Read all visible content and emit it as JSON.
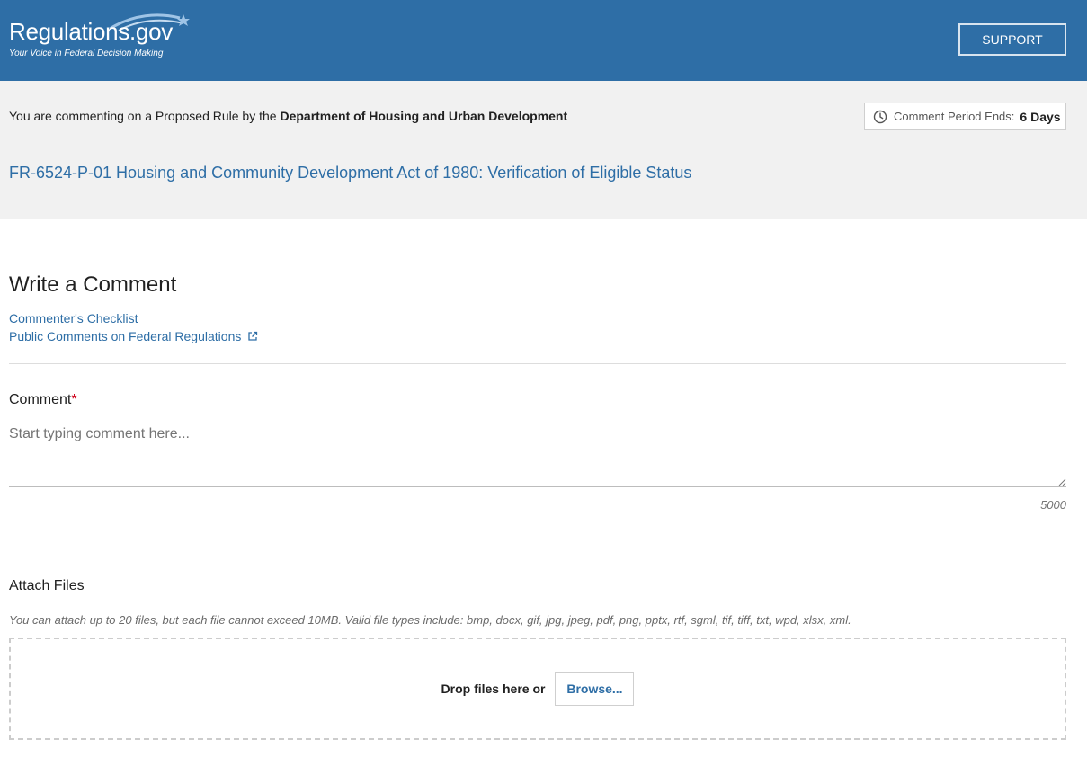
{
  "header": {
    "logo_text": "Regulations.gov",
    "logo_tagline": "Your Voice in Federal Decision Making",
    "support_label": "SUPPORT"
  },
  "context": {
    "intro_prefix": "You are commenting on a Proposed Rule by the ",
    "agency": "Department of Housing and Urban Development",
    "period_label": "Comment Period Ends:",
    "period_value": "6 Days",
    "document_title": "FR-6524-P-01 Housing and Community Development Act of 1980: Verification of Eligible Status"
  },
  "main": {
    "heading": "Write a Comment",
    "links": [
      {
        "label": "Commenter's Checklist"
      },
      {
        "label": "Public Comments on Federal Regulations"
      }
    ],
    "comment": {
      "label": "Comment",
      "required_marker": "*",
      "placeholder": "Start typing comment here...",
      "value": "",
      "char_limit": "5000"
    },
    "attach": {
      "label": "Attach Files",
      "help": "You can attach up to 20 files, but each file cannot exceed 10MB. Valid file types include: bmp, docx, gif, jpg, jpeg, pdf, png, pptx, rtf, sgml, tif, tiff, txt, wpd, xlsx, xml.",
      "drop_text": "Drop files here or",
      "browse_label": "Browse..."
    }
  },
  "icons": {
    "clock": "clock-icon",
    "external_link": "external-link-icon",
    "resize": "resize-grip-icon"
  },
  "colors": {
    "header_bg": "#2e6ea6",
    "link": "#2e6ea6",
    "band_bg": "#f1f1f1",
    "required": "#d0021b"
  }
}
